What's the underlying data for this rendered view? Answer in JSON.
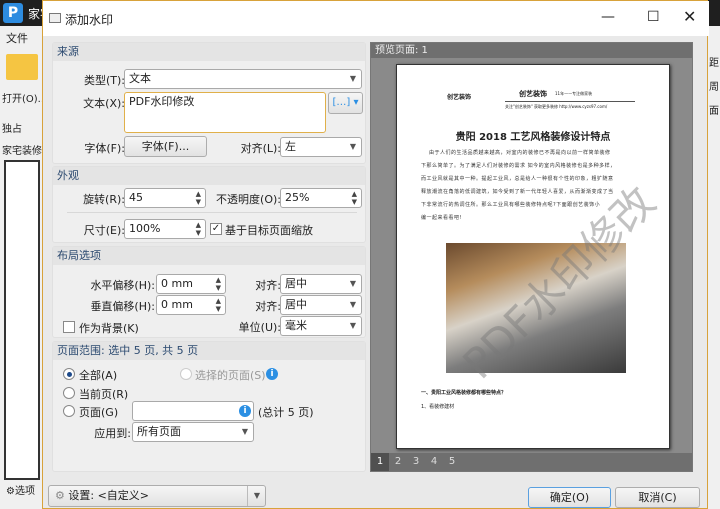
{
  "app": {
    "title": "家宅",
    "menu_file": "文件",
    "open_label": "打开(O)...",
    "exclusive": "独占",
    "doc_tab": "家宅装修",
    "options": "选项",
    "right_items": [
      "距",
      "周",
      "面"
    ]
  },
  "dialog": {
    "title": "添加水印",
    "source": {
      "heading": "来源",
      "type_label": "类型(T):",
      "type_value": "文本",
      "text_label": "文本(X):",
      "text_value": "PDF水印修改",
      "font_label": "字体(F):",
      "font_button": "字体(F)...",
      "align_label": "对齐(L):",
      "align_value": "左",
      "insert_icon": "[…]"
    },
    "appearance": {
      "heading": "外观",
      "rotate_label": "旋转(R):",
      "rotate_value": "45",
      "opacity_label": "不透明度(O):",
      "opacity_value": "25%",
      "size_label": "尺寸(E):",
      "size_value": "100%",
      "scale_label": "基于目标页面缩放",
      "scale_checked": true
    },
    "layout": {
      "heading": "布局选项",
      "hoffset_label": "水平偏移(H):",
      "hoffset_value": "0 mm",
      "voffset_label": "垂直偏移(H):",
      "voffset_value": "0 mm",
      "halign_label": "对齐:",
      "halign_value": "居中",
      "valign_label": "对齐:",
      "valign_value": "居中",
      "unit_label": "单位(U):",
      "unit_value": "毫米",
      "background_label": "作为背景(K)",
      "background_checked": false
    },
    "range": {
      "heading": "页面范围: 选中 5 页, 共 5 页",
      "all": "全部(A)",
      "selected": "选择的页面(S)",
      "current": "当前页(R)",
      "pages": "页面(G)",
      "pages_value": "",
      "total": "(总计 5 页)",
      "apply_label": "应用到:",
      "apply_value": "所有页面"
    },
    "preview": {
      "heading": "预览页面: 1",
      "pages": [
        "1",
        "2",
        "3",
        "4",
        "5"
      ],
      "current_page": "1",
      "doc": {
        "brand": "创艺装饰",
        "brand_sub": "11年——专注做家装",
        "logo_text": "创艺装饰",
        "url_line": "关注\"创艺装饰\" 获取更多装修 http://www.cyzs97.com/",
        "title": "贵阳 2018 工艺风格装修设计特点",
        "paras": [
          "由于人们的生活品质越来越高，对室内的装修已不再是向以前一样简单装修",
          "下那么简单了。为了满足人们对装修的需求 如今的室内风格装修也是多种多样，",
          "而工业风就是其中一种。提起工业风，总是给人一种很有个性的印象，粗犷随意",
          "释放潮流在角落的低调建筑，如今受到了新一代年轻人喜爱，从而渐渐变成了当",
          "下非常流行的热调住所。那么工业风有哪些装修特点呢?下面跟创艺装饰小",
          "编一起来看看吧!"
        ],
        "section": "一、贵阳工业风格装修都有哪些特点？",
        "item": "1、看装修建材",
        "watermark": "PDF水印修改"
      }
    },
    "settings_label": "设置: <自定义>",
    "ok": "确定(O)",
    "cancel": "取消(C)"
  }
}
